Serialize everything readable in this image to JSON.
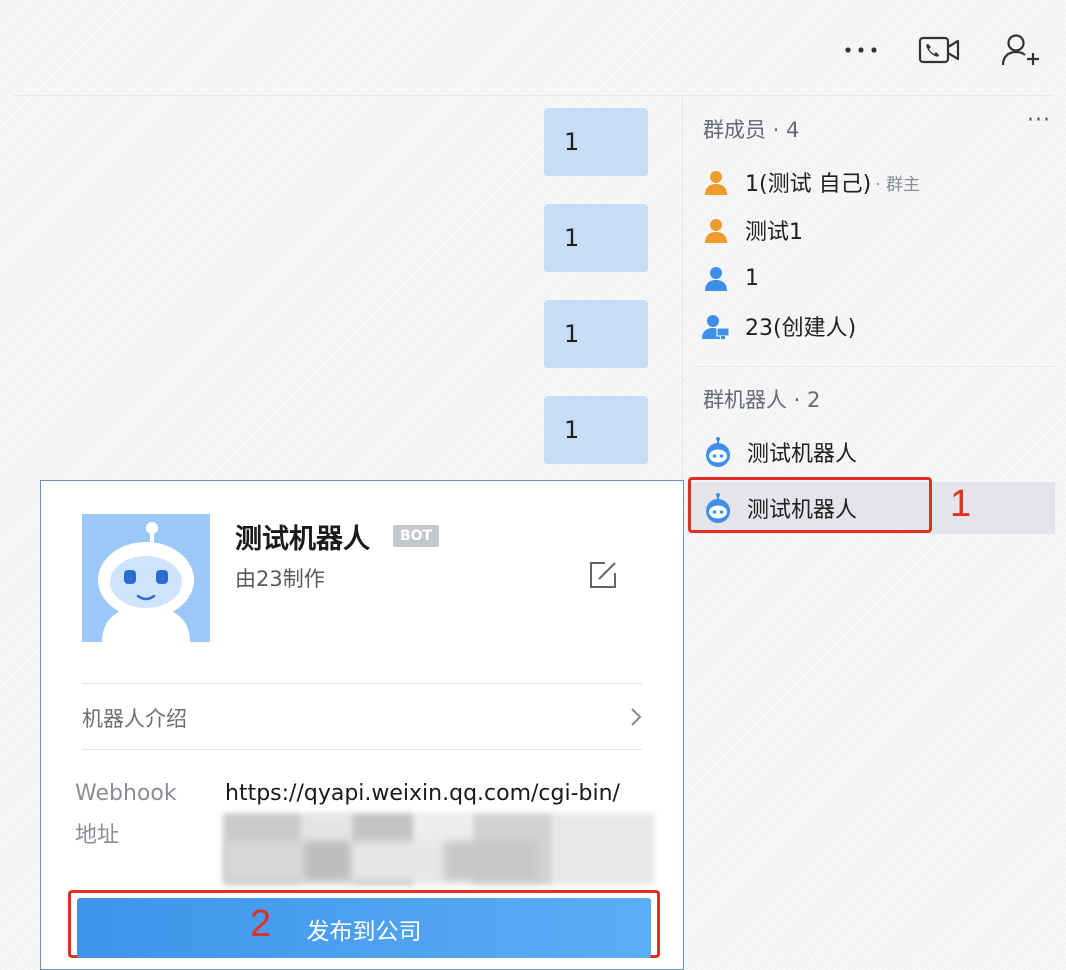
{
  "messages": [
    "1",
    "1",
    "1",
    "1"
  ],
  "sidebar": {
    "members_title": "群成员 · 4",
    "members": [
      {
        "name": "1(测试 自己)",
        "tag": "· 群主",
        "icon": "user-orange-icon"
      },
      {
        "name": "测试1",
        "tag": "",
        "icon": "user-orange-icon"
      },
      {
        "name": "1",
        "tag": "",
        "icon": "user-blue-icon"
      },
      {
        "name": "23(创建人)",
        "tag": "",
        "icon": "user-desktop-icon"
      }
    ],
    "robots_title": "群机器人 · 2",
    "robots": [
      {
        "name": "测试机器人",
        "icon": "robot-icon"
      },
      {
        "name": "测试机器人",
        "icon": "robot-icon"
      }
    ],
    "more": "···"
  },
  "topbar": {
    "more": "···"
  },
  "card": {
    "name": "测试机器人",
    "badge": "BOT",
    "creator": "由23制作",
    "intro_label": "机器人介绍",
    "webhook_label_line1": "Webhook",
    "webhook_label_line2": "地址",
    "webhook_url": "https://qyapi.weixin.qq.com/cgi-bin/",
    "publish_label": "发布到公司"
  },
  "annotations": {
    "step1": "1",
    "step2": "2"
  },
  "colors": {
    "accent": "#3f93ea",
    "highlight": "#e02f24",
    "bubble": "#c7ddf7"
  }
}
